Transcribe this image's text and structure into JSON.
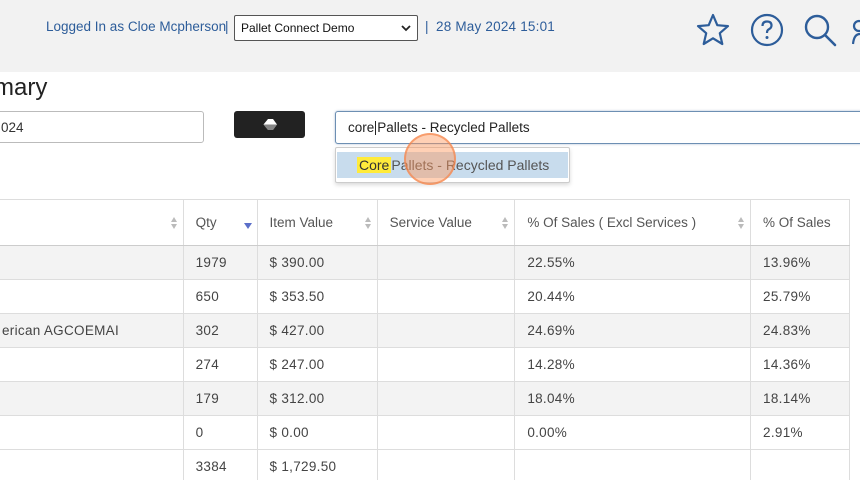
{
  "header": {
    "logged_in": "Logged In as Cloe Mcpherson",
    "separator": "|",
    "company_select": {
      "selected": "Pallet Connect Demo"
    },
    "datetime": "28 May 2024 15:01",
    "icons": [
      "star-icon",
      "help-icon",
      "search-icon",
      "user-icon"
    ]
  },
  "page": {
    "title": "mary"
  },
  "filters": {
    "date_value": "024",
    "clear_button_icon": "eraser-icon",
    "search": {
      "typed": "core",
      "rest": " Pallets - Recycled Pallets"
    },
    "suggestion": {
      "match": "Core",
      "rest": " Pallets - Recycled Pallets"
    }
  },
  "table": {
    "columns": [
      "",
      "Qty",
      "Item Value",
      "Service Value",
      "% Of Sales ( Excl Services )",
      "% Of Sales"
    ],
    "rows": [
      {
        "name": "",
        "qty": "1979",
        "item_value": "$ 390.00",
        "service_value": "",
        "pct_excl": "22.55%",
        "pct": "13.96%"
      },
      {
        "name": "",
        "qty": "650",
        "item_value": "$ 353.50",
        "service_value": "",
        "pct_excl": "20.44%",
        "pct": "25.79%"
      },
      {
        "name": "erican AGCOEMAI",
        "qty": "302",
        "item_value": "$ 427.00",
        "service_value": "",
        "pct_excl": "24.69%",
        "pct": "24.83%"
      },
      {
        "name": "",
        "qty": "274",
        "item_value": "$ 247.00",
        "service_value": "",
        "pct_excl": "14.28%",
        "pct": "14.36%"
      },
      {
        "name": "",
        "qty": "179",
        "item_value": "$ 312.00",
        "service_value": "",
        "pct_excl": "18.04%",
        "pct": "18.14%"
      },
      {
        "name": "",
        "qty": "0",
        "item_value": "$ 0.00",
        "service_value": "",
        "pct_excl": "0.00%",
        "pct": "2.91%"
      }
    ],
    "totals": {
      "name": "",
      "qty": "3384",
      "item_value": "$ 1,729.50",
      "service_value": "",
      "pct_excl": "",
      "pct": ""
    }
  }
}
